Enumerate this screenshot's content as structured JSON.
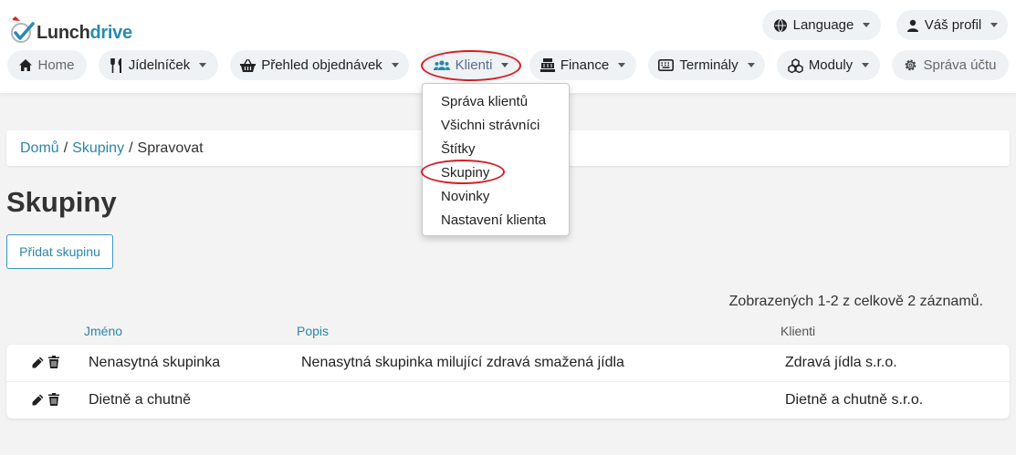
{
  "logo": {
    "lunch": "Lunch",
    "drive": "drive"
  },
  "top_right": {
    "language": "Language",
    "profile": "Váš profil"
  },
  "nav": {
    "home": "Home",
    "menu": "Jídelníček",
    "orders": "Přehled objednávek",
    "clients": "Klienti",
    "finance": "Finance",
    "terminals": "Terminály",
    "modules": "Moduly",
    "account": "Správa účtu"
  },
  "dropdown": [
    "Správa klientů",
    "Všichni strávníci",
    "Štítky",
    "Skupiny",
    "Novinky",
    "Nastavení klienta"
  ],
  "breadcrumb": {
    "home": "Domů",
    "groups": "Skupiny",
    "current": "Spravovat"
  },
  "page": {
    "title": "Skupiny",
    "add_button": "Přidat skupinu",
    "count": "Zobrazených 1-2 z celkově 2 záznamů."
  },
  "table": {
    "headers": {
      "name": "Jméno",
      "description": "Popis",
      "clients": "Klienti"
    },
    "rows": [
      {
        "name": "Nenasytná skupinka",
        "description": "Nenasytná skupinka milující zdravá smažená jídla",
        "client": "Zdravá jídla s.r.o."
      },
      {
        "name": "Dietně a chutně",
        "description": "",
        "client": "Dietně a chutně s.r.o."
      }
    ]
  },
  "colors": {
    "accent": "#2b86a8",
    "highlight": "#d42027",
    "pill_bg": "#eef2f5"
  },
  "icons": [
    "globe-icon",
    "user-icon",
    "home-icon",
    "cutlery-icon",
    "basket-icon",
    "users-icon",
    "cash-register-icon",
    "terminal-icon",
    "modules-icon",
    "gear-icon",
    "pencil-icon",
    "trash-icon"
  ]
}
